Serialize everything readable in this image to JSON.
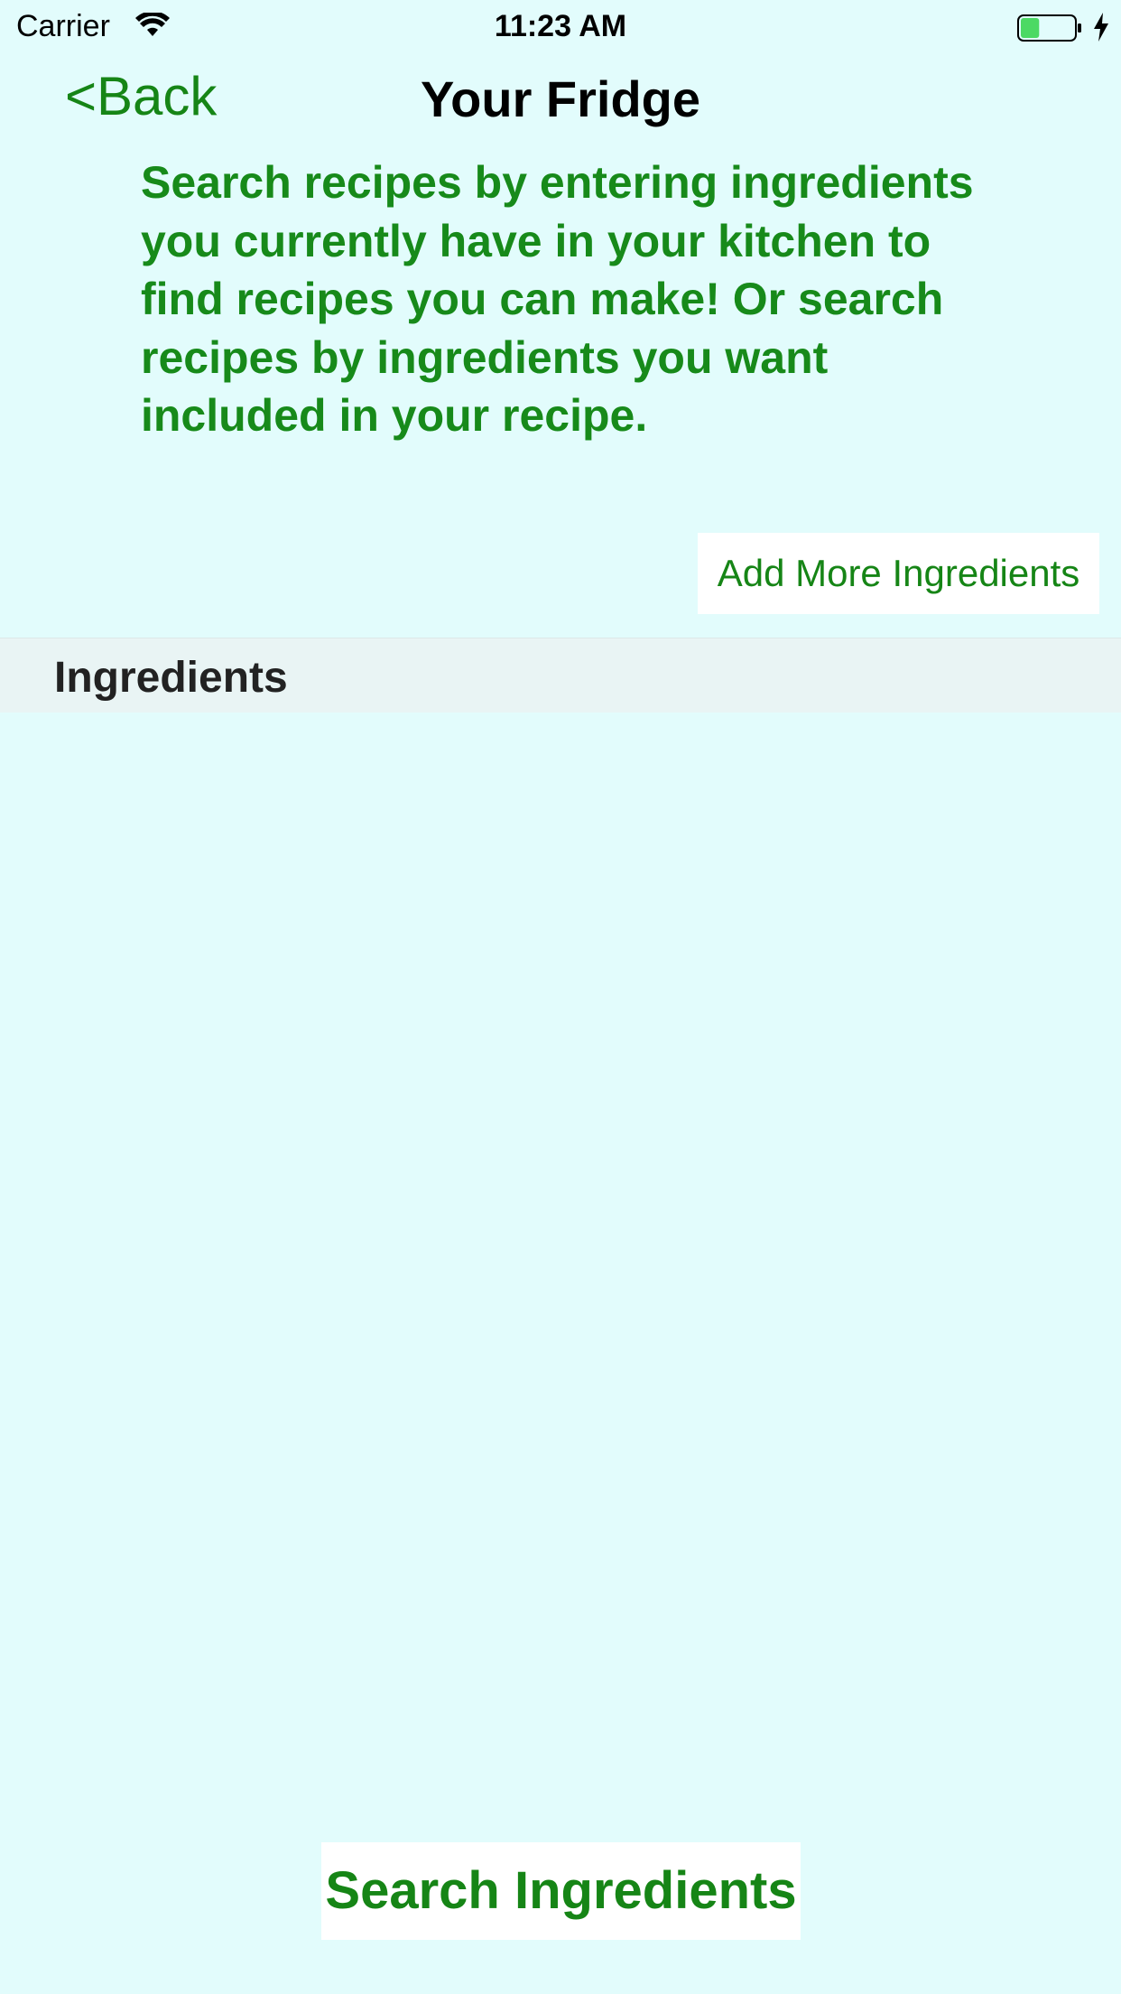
{
  "status_bar": {
    "carrier": "Carrier",
    "time": "11:23 AM",
    "battery_level": 0.35,
    "battery_color": "#4cd964",
    "icons": [
      "wifi-icon",
      "battery-icon",
      "charging-icon"
    ]
  },
  "nav": {
    "back_label": "<Back",
    "title": "Your Fridge"
  },
  "description": "Search recipes by entering ingredients you currently have in your kitchen to find recipes you can make! Or search recipes by ingredients you want included in your recipe.",
  "add_button_label": "Add More Ingredients",
  "section": {
    "header": "Ingredients",
    "items": []
  },
  "search_button_label": "Search Ingredients",
  "colors": {
    "background": "#e2fcfc",
    "accent": "#168516",
    "section_header_bg": "#e9f4f4"
  }
}
